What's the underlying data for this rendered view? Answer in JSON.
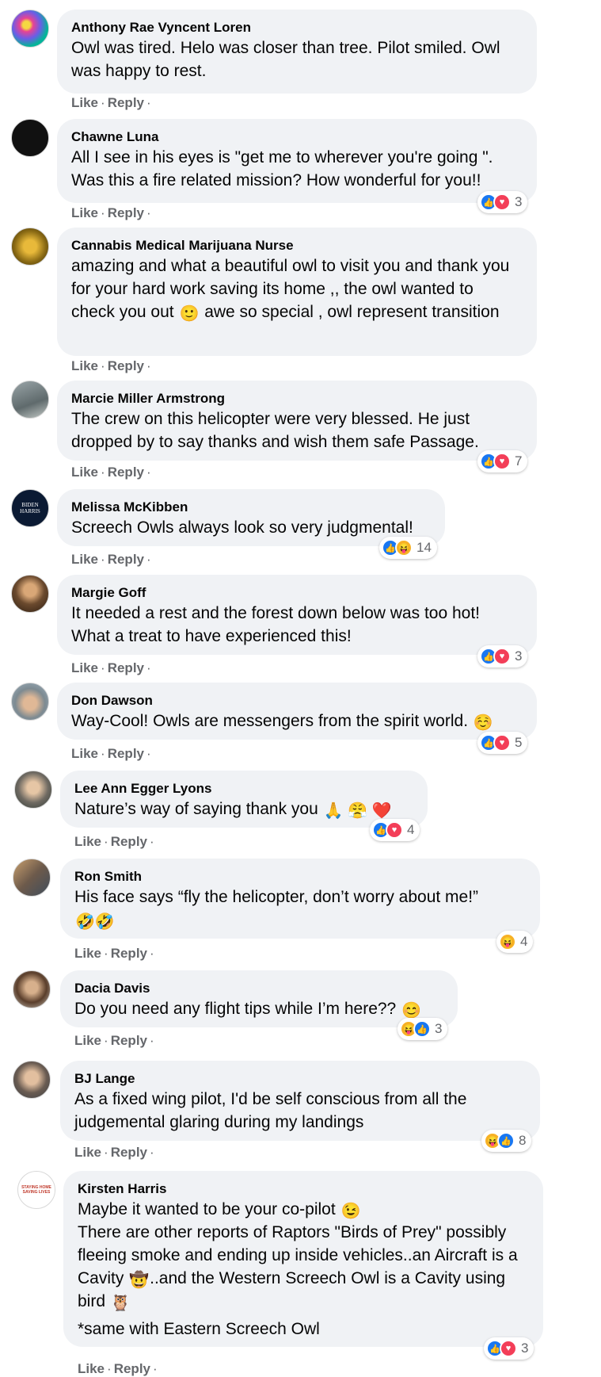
{
  "comments": [
    {
      "author": "Anthony Rae Vyncent Loren",
      "text": "Owl was tired. Helo was closer than tree. Pilot smiled. Owl was happy to rest.",
      "like": "Like",
      "reply": "Reply"
    },
    {
      "author": "Chawne Luna",
      "text": "All I see in his eyes is \"get me to wherever you're going \". Was this a fire related mission? How wonderful for you!!",
      "like": "Like",
      "reply": "Reply",
      "reaction_count": "3"
    },
    {
      "author": "Cannabis Medical Marijuana Nurse",
      "text_before": "amazing and what a beautiful owl to visit you and thank you for your hard work saving its home ,, the owl wanted to check you out",
      "emoji": "🙂",
      "text_after": "awe so special , owl represent transition",
      "like": "Like",
      "reply": "Reply"
    },
    {
      "author": "Marcie Miller Armstrong",
      "text": "The crew on this helicopter were very blessed. He just dropped by to say thanks and wish them safe Passage.",
      "like": "Like",
      "reply": "Reply",
      "reaction_count": "7"
    },
    {
      "author": "Melissa McKibben",
      "text": "Screech Owls always look so very judgmental!",
      "like": "Like",
      "reply": "Reply",
      "reaction_count": "14"
    },
    {
      "author": "Margie Goff",
      "text": "It needed a rest and the forest down below was too hot! What a treat to have experienced this!",
      "like": "Like",
      "reply": "Reply",
      "reaction_count": "3"
    },
    {
      "author": "Don Dawson",
      "text": "Way-Cool! Owls are messengers from the spirit world.",
      "emoji": "☺️",
      "like": "Like",
      "reply": "Reply",
      "reaction_count": "5"
    },
    {
      "author": "Lee Ann Egger Lyons",
      "text": "Nature’s way of saying thank you",
      "emoji": "🙏 😤 ❤️",
      "like": "Like",
      "reply": "Reply",
      "reaction_count": "4"
    },
    {
      "author": "Ron Smith",
      "text": "His face says “fly the helicopter, don’t worry about me!”",
      "emoji": "🤣🤣",
      "like": "Like",
      "reply": "Reply",
      "reaction_count": "4"
    },
    {
      "author": "Dacia Davis",
      "text": "Do you need any flight tips while I’m here??",
      "emoji": "😊",
      "like": "Like",
      "reply": "Reply",
      "reaction_count": "3"
    },
    {
      "author": "BJ Lange",
      "text": "As a fixed wing pilot, I'd be self conscious from all the judgemental glaring during my landings",
      "like": "Like",
      "reply": "Reply",
      "reaction_count": "8"
    },
    {
      "author": "Kirsten Harris",
      "line1": "Maybe it wanted to be your co-pilot",
      "emoji1": "😉",
      "line2a": "There are other reports of Raptors \"Birds of Prey\" possibly fleeing smoke and ending up inside vehicles..an Aircraft is a Cavity",
      "emoji2": "🤠",
      "line2b": "..and the Western Screech Owl is a Cavity using bird",
      "emoji3": "🦉",
      "line3": "*same with Eastern Screech Owl",
      "like": "Like",
      "reply": "Reply",
      "reaction_count": "3"
    }
  ],
  "avatar_glyphs": {
    "melissa": "BIDEN HARRIS",
    "kirsten": "STAYING HOME SAVING LIVES"
  },
  "colors": {
    "bubble": "#f0f2f5",
    "like": "#1877f2",
    "love": "#f33e58",
    "haha": "#f7b125",
    "meta": "#65676b"
  }
}
